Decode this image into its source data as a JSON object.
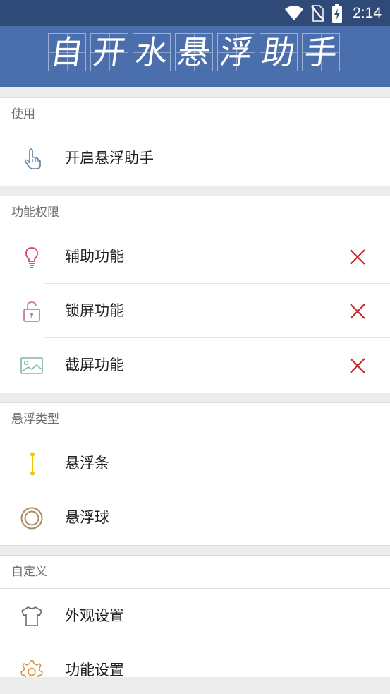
{
  "status_bar": {
    "time": "2:14",
    "icons": [
      "wifi-icon",
      "no-sim-icon",
      "battery-charging-icon"
    ]
  },
  "header": {
    "title_chars": [
      "自",
      "开",
      "水",
      "悬",
      "浮",
      "助",
      "手"
    ]
  },
  "sections": {
    "usage": {
      "header": "使用",
      "items": [
        {
          "label": "开启悬浮助手",
          "icon": "hand-pointer-icon"
        }
      ]
    },
    "permissions": {
      "header": "功能权限",
      "items": [
        {
          "label": "辅助功能",
          "icon": "lightbulb-icon",
          "status": "disabled-x-icon"
        },
        {
          "label": "锁屏功能",
          "icon": "lock-icon",
          "status": "disabled-x-icon"
        },
        {
          "label": "截屏功能",
          "icon": "image-icon",
          "status": "disabled-x-icon"
        }
      ]
    },
    "float_type": {
      "header": "悬浮类型",
      "items": [
        {
          "label": "悬浮条",
          "icon": "float-bar-icon"
        },
        {
          "label": "悬浮球",
          "icon": "float-ball-icon"
        }
      ]
    },
    "custom": {
      "header": "自定义",
      "items": [
        {
          "label": "外观设置",
          "icon": "shirt-icon"
        },
        {
          "label": "功能设置",
          "icon": "gear-icon"
        }
      ]
    }
  },
  "colors": {
    "status_bar": "#2f4a77",
    "header": "#4b6ead",
    "status_x": "#c62828",
    "background": "#ececec"
  }
}
